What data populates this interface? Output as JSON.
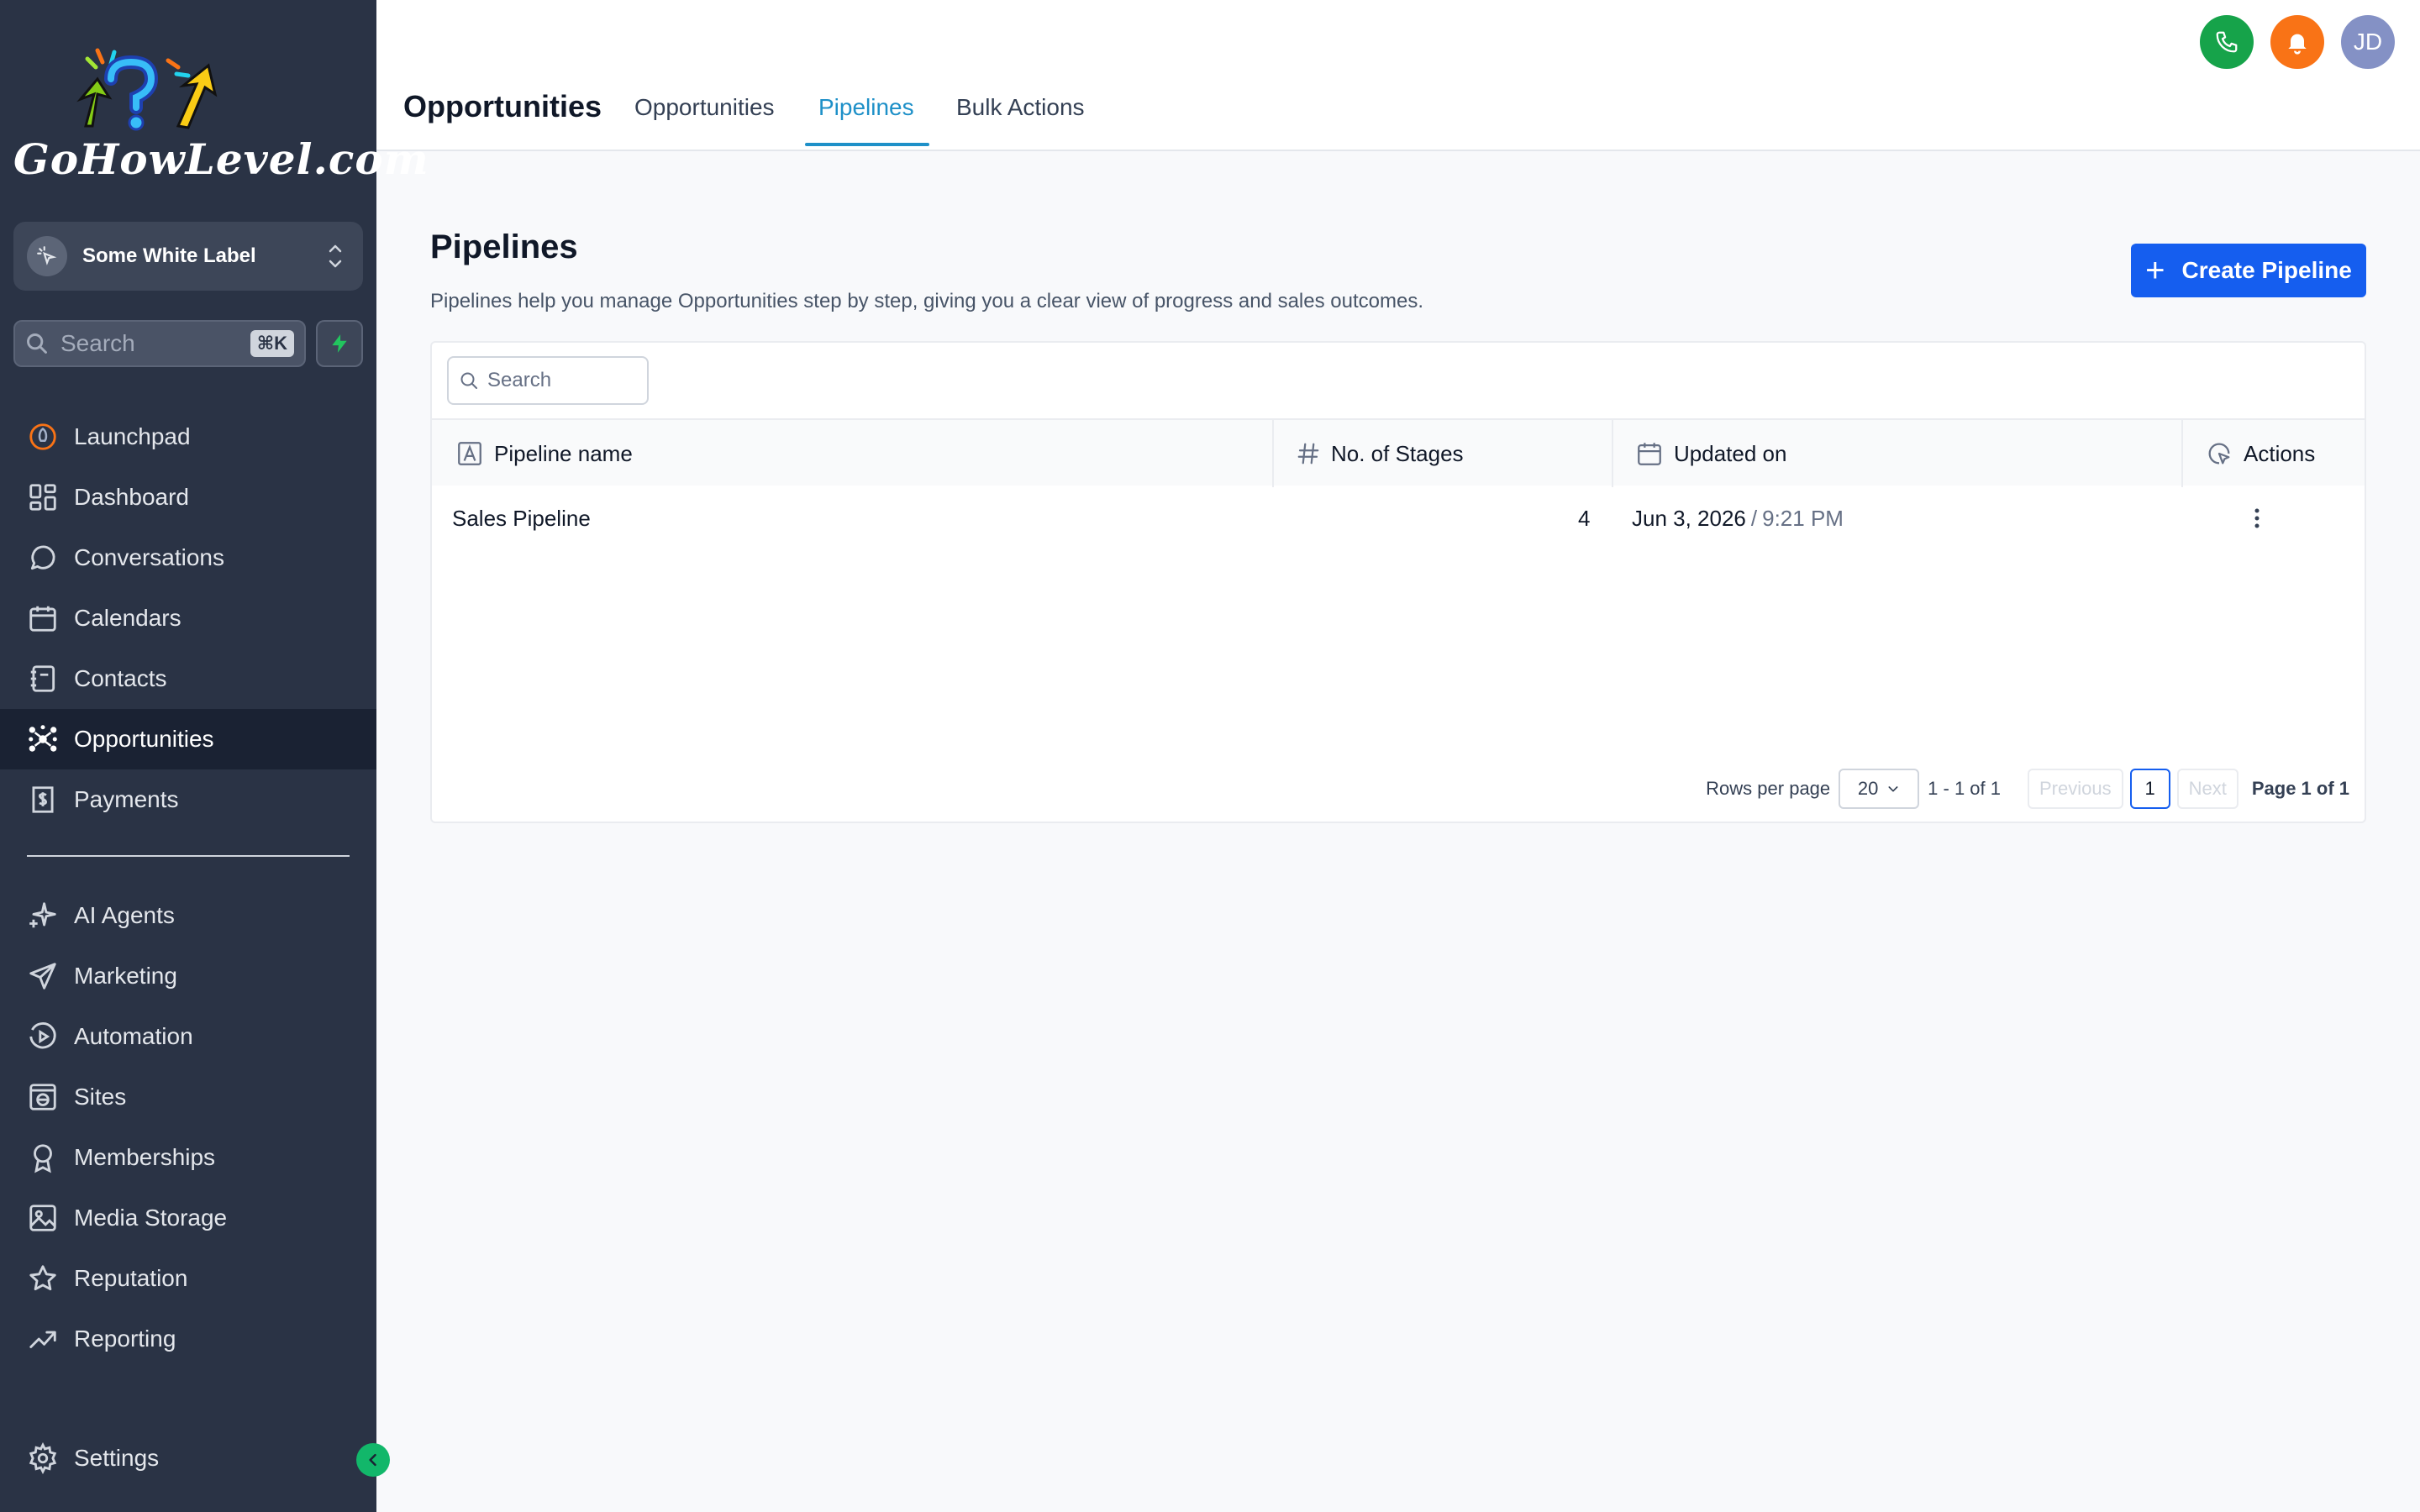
{
  "brand": {
    "logo_text": "GoHowLevel.com"
  },
  "account": {
    "name": "Some White Label"
  },
  "sidebar_search": {
    "placeholder": "Search",
    "shortcut": "⌘K"
  },
  "nav_primary": [
    {
      "label": "Launchpad",
      "icon": "rocket-icon"
    },
    {
      "label": "Dashboard",
      "icon": "dashboard-grid-icon"
    },
    {
      "label": "Conversations",
      "icon": "chat-bubble-icon"
    },
    {
      "label": "Calendars",
      "icon": "calendar-icon"
    },
    {
      "label": "Contacts",
      "icon": "contact-book-icon"
    },
    {
      "label": "Opportunities",
      "icon": "network-icon",
      "active": true
    },
    {
      "label": "Payments",
      "icon": "dollar-receipt-icon"
    }
  ],
  "nav_secondary": [
    {
      "label": "AI Agents",
      "icon": "sparkle-icon"
    },
    {
      "label": "Marketing",
      "icon": "send-icon"
    },
    {
      "label": "Automation",
      "icon": "play-circle-icon"
    },
    {
      "label": "Sites",
      "icon": "globe-window-icon"
    },
    {
      "label": "Memberships",
      "icon": "award-icon"
    },
    {
      "label": "Media Storage",
      "icon": "image-icon"
    },
    {
      "label": "Reputation",
      "icon": "star-icon"
    },
    {
      "label": "Reporting",
      "icon": "trend-up-icon"
    }
  ],
  "nav_settings": {
    "label": "Settings",
    "icon": "gear-icon"
  },
  "header": {
    "title": "Opportunities",
    "tabs": [
      {
        "label": "Opportunities"
      },
      {
        "label": "Pipelines",
        "active": true
      },
      {
        "label": "Bulk Actions"
      }
    ],
    "user_initials": "JD"
  },
  "page": {
    "heading": "Pipelines",
    "description": "Pipelines help you manage Opportunities step by step, giving you a clear view of progress and sales outcomes.",
    "create_button": "Create Pipeline"
  },
  "table": {
    "search_placeholder": "Search",
    "columns": [
      "Pipeline name",
      "No. of Stages",
      "Updated on",
      "Actions"
    ],
    "rows": [
      {
        "name": "Sales Pipeline",
        "stages": "4",
        "updated_date": "Jun 3, 2026",
        "updated_sep": "/",
        "updated_time": "9:21 PM"
      }
    ]
  },
  "pagination": {
    "rows_per_page_label": "Rows per page",
    "rows_per_page": "20",
    "range": "1 - 1 of 1",
    "previous": "Previous",
    "current": "1",
    "next": "Next",
    "page_of": "Page 1 of 1"
  },
  "colors": {
    "sidebar_bg": "#2a3345",
    "accent_blue": "#155eef",
    "tab_active": "#1e90c8",
    "phone_green": "#16a34a",
    "bell_orange": "#f97316",
    "avatar_purple": "#8491c5"
  }
}
